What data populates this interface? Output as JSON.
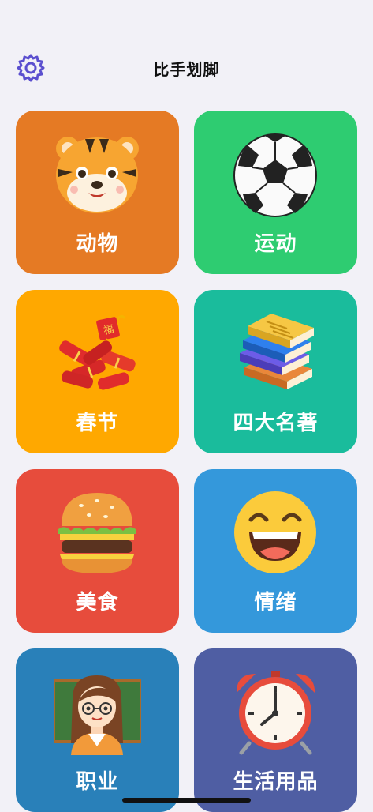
{
  "header": {
    "title": "比手划脚",
    "settings_icon": "gear-icon"
  },
  "categories": [
    {
      "label": "动物",
      "color": "#e57a24",
      "icon": "tiger-icon"
    },
    {
      "label": "运动",
      "color": "#2ecc71",
      "icon": "soccer-ball-icon"
    },
    {
      "label": "春节",
      "color": "#ffa800",
      "icon": "firecracker-icon"
    },
    {
      "label": "四大名著",
      "color": "#1abc9c",
      "icon": "books-icon"
    },
    {
      "label": "美食",
      "color": "#e74c3c",
      "icon": "burger-icon"
    },
    {
      "label": "情绪",
      "color": "#3498db",
      "icon": "smiley-icon"
    },
    {
      "label": "职业",
      "color": "#2980b9",
      "icon": "teacher-icon"
    },
    {
      "label": "生活用品",
      "color": "#4f5ea3",
      "icon": "alarm-clock-icon"
    }
  ]
}
